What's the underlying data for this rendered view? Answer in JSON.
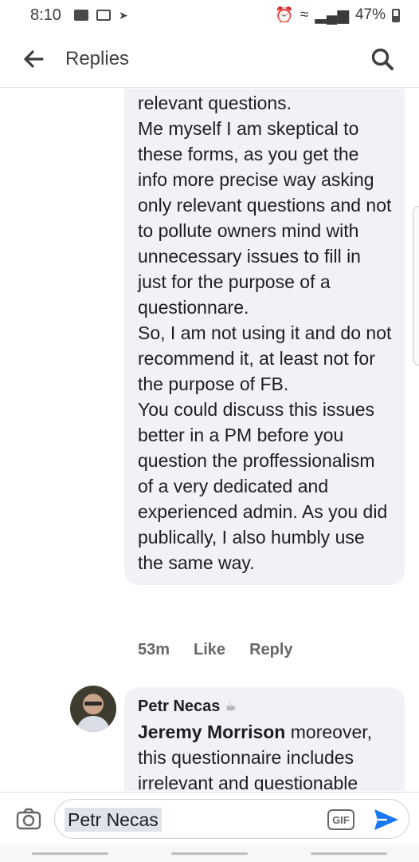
{
  "status_bar": {
    "time": "8:10",
    "battery": "47%"
  },
  "header": {
    "title": "Replies"
  },
  "comment": {
    "text": "relevant questions.\nMe myself I am skeptical to these forms, as you get the info more precise way asking only relevant questions and not to pollute owners mind with unnecessary issues to fill in just for the purpose of a questionnare.\nSo, I am not using it and do not recommend it, at least not for the purpose of FB.\nYou could discuss this issues better in a PM before you question the proffessionalism of a very dedicated and experienced admin. As you did publically, I also humbly use the same way.",
    "time": "53m",
    "like_label": "Like",
    "reply_label": "Reply"
  },
  "reply": {
    "author": "Petr Necas",
    "mention": "Jeremy Morrison",
    "text": " moreover, this questionnaire includes irrelevant and questionable"
  },
  "composer": {
    "value": "Petr Necas",
    "gif_label": "GIF"
  }
}
